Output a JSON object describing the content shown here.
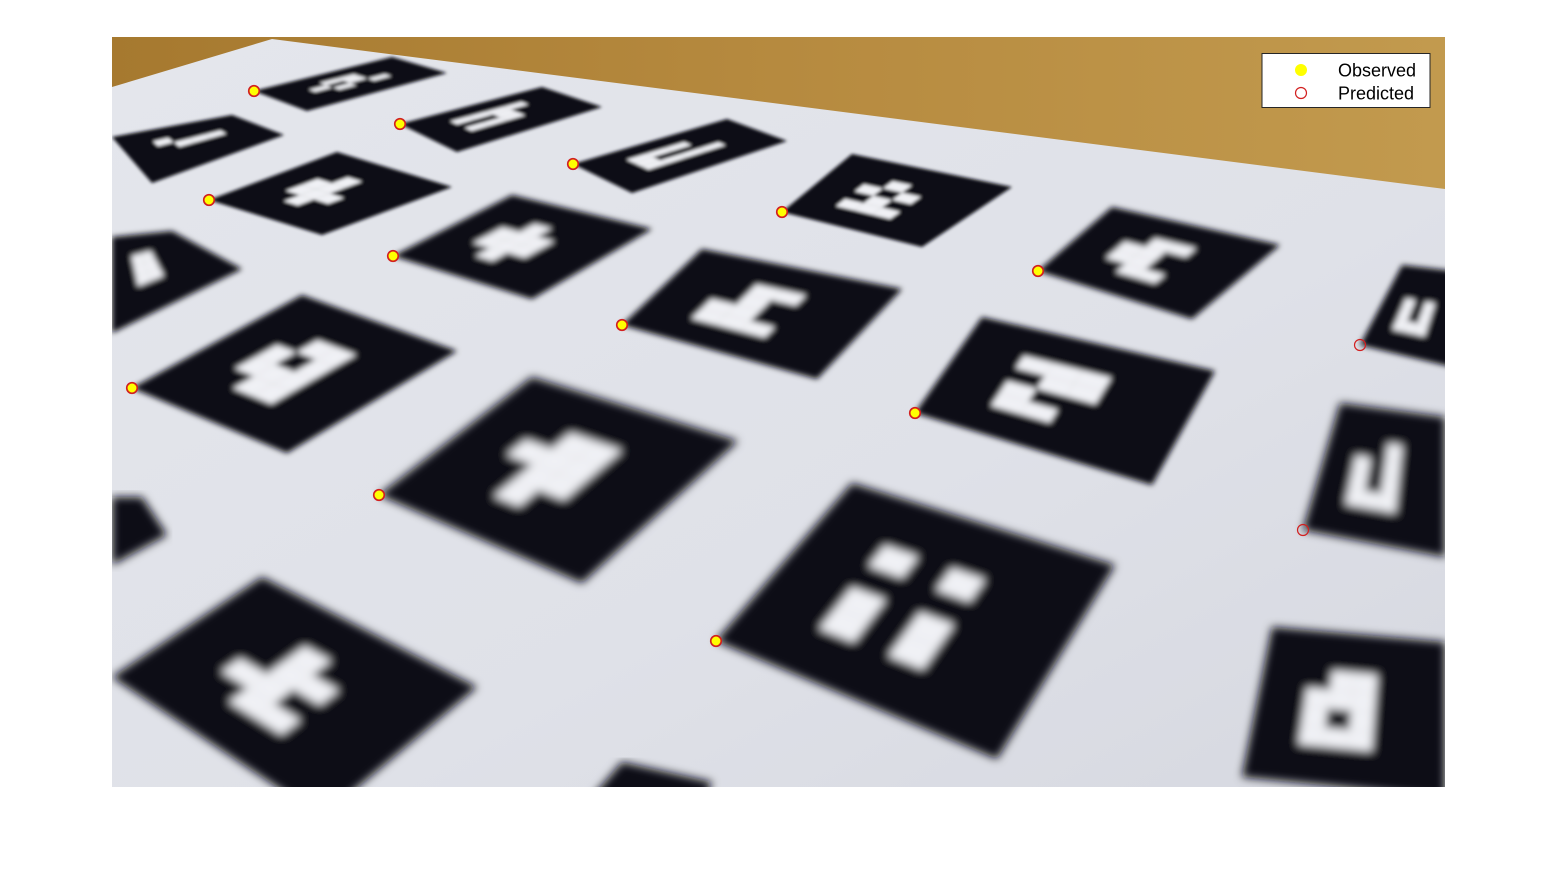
{
  "chart_data": {
    "type": "scatter",
    "image_size": [
      1333,
      750
    ],
    "series": [
      {
        "name": "Observed",
        "marker": "filled-circle",
        "color": "#ffff00",
        "edge_color": "#d21f1f",
        "points": [
          [
            142,
            54
          ],
          [
            288,
            87
          ],
          [
            461,
            127
          ],
          [
            670,
            175
          ],
          [
            926,
            234
          ],
          [
            97,
            163
          ],
          [
            281,
            219
          ],
          [
            510,
            288
          ],
          [
            803,
            376
          ],
          [
            20,
            351
          ],
          [
            267,
            458
          ],
          [
            604,
            604
          ]
        ]
      },
      {
        "name": "Predicted",
        "marker": "open-circle",
        "color": "#d21f1f",
        "points": [
          [
            142,
            54
          ],
          [
            288,
            87
          ],
          [
            461,
            127
          ],
          [
            670,
            175
          ],
          [
            926,
            234
          ],
          [
            1248,
            308
          ],
          [
            97,
            163
          ],
          [
            281,
            219
          ],
          [
            510,
            288
          ],
          [
            803,
            376
          ],
          [
            1191,
            493
          ],
          [
            20,
            351
          ],
          [
            267,
            458
          ],
          [
            604,
            604
          ]
        ]
      }
    ],
    "legend": {
      "position": "top-right",
      "entries": [
        "Observed",
        "Predicted"
      ]
    },
    "background": "camera image of ArUco marker calibration board on wooden table",
    "grid": false
  }
}
